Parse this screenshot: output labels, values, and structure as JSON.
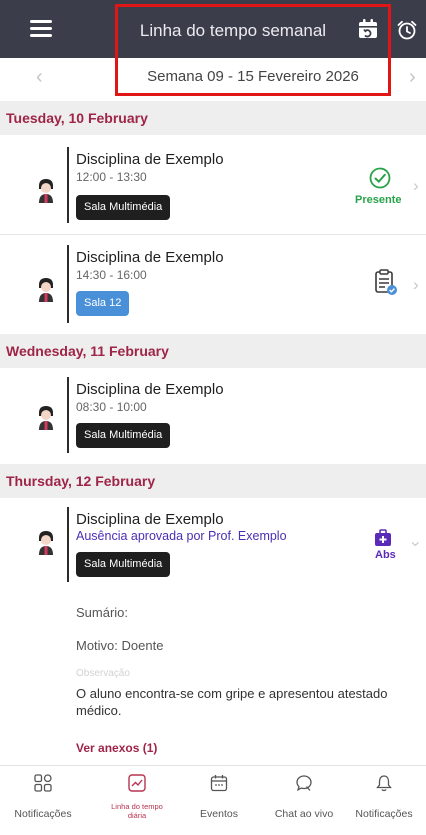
{
  "header": {
    "title": "Linha do tempo semanal",
    "icons": [
      "menu-icon",
      "calendar-icon",
      "alarm-clock-icon"
    ]
  },
  "week": {
    "label": "Semana 09 - 15 Fevereiro 2026",
    "prev": "‹",
    "next": "›"
  },
  "days": [
    {
      "header": "Tuesday, 10 February",
      "lessons": [
        {
          "title": "Disciplina de Exemplo",
          "time": "12:00 - 13:30",
          "room": "Sala Multimédia",
          "status": "Presente"
        },
        {
          "title": "Disciplina de Exemplo",
          "time": "14:30 - 16:00",
          "room": "Sala 12",
          "status_icon": "clipboard-icon"
        }
      ]
    },
    {
      "header": "Wednesday, 11 February",
      "lessons": [
        {
          "title": "Disciplina de Exemplo",
          "time": "08:30 - 10:00",
          "room": "Sala Multimédia"
        }
      ]
    },
    {
      "header": "Thursday, 12 February",
      "lessons": [
        {
          "title": "Disciplina de Exemplo",
          "note": "Ausência aprovada por Prof. Exemplo",
          "room": "Sala Multimédia",
          "status": "Abs",
          "details": {
            "summary": "Sumário:",
            "reason": "Motivo: Doente",
            "observation_label": "Observação",
            "observation": "O aluno encontra-se com gripe e apresentou atestado médico.",
            "attachments": "Ver anexos (1)"
          }
        }
      ]
    }
  ],
  "bottom_nav": [
    {
      "label": "Notificações",
      "icon": "grid-icon"
    },
    {
      "label": "Linha do tempo diária",
      "icon": "timeline-icon",
      "active": true
    },
    {
      "label": "Eventos",
      "icon": "calendar-icon"
    },
    {
      "label": "Chat ao vivo",
      "icon": "chat-icon"
    },
    {
      "label": "Notificações",
      "icon": "bell-icon"
    }
  ],
  "colors": {
    "topbar": "#3c3d4a",
    "accent": "#9e2448",
    "present": "#2aa24a",
    "absence": "#5a2bb8",
    "room_dark": "#1f1f1f",
    "room_blue": "#4a90d9"
  }
}
